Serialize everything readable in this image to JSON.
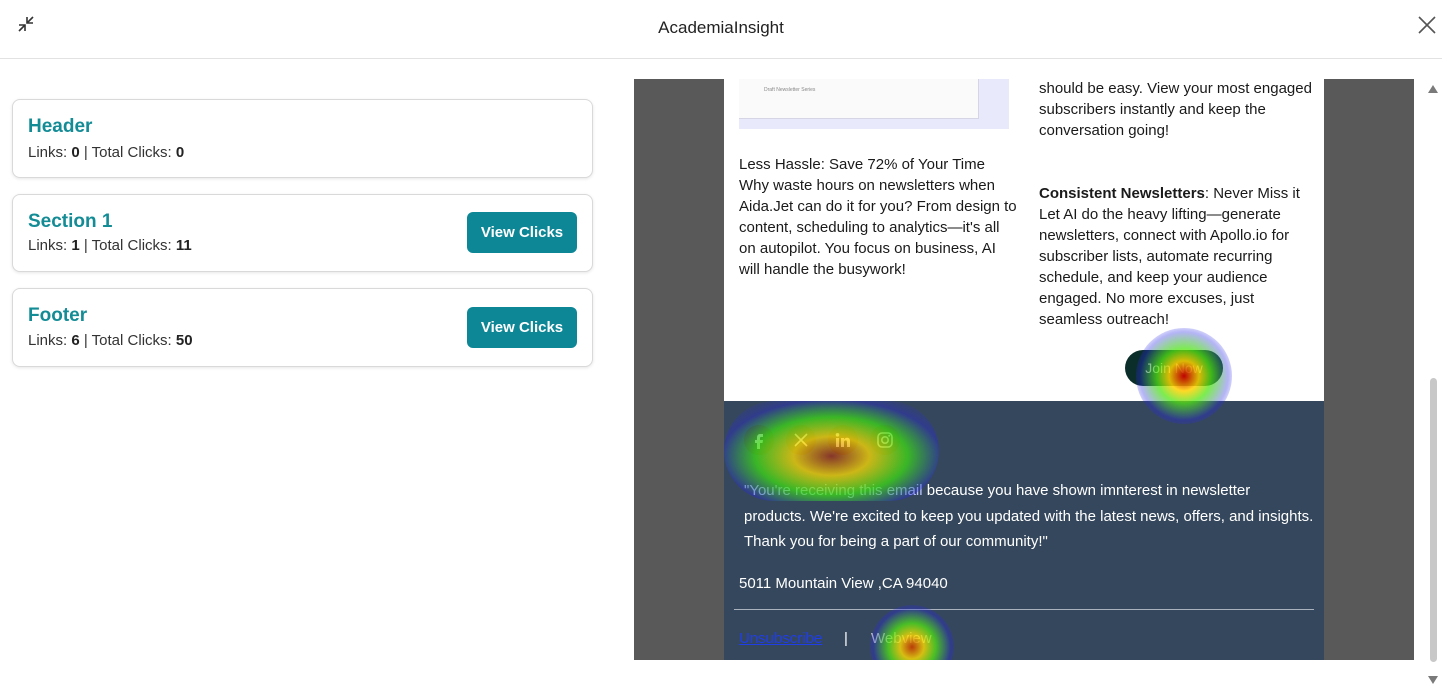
{
  "app": {
    "title": "AcademiaInsight"
  },
  "sections": [
    {
      "name": "Header",
      "links_label": "Links:",
      "links": "0",
      "clicks_label": "Total Clicks:",
      "clicks": "0",
      "button": ""
    },
    {
      "name": "Section 1",
      "links_label": "Links:",
      "links": "1",
      "clicks_label": "Total Clicks:",
      "clicks": "11",
      "button": "View Clicks"
    },
    {
      "name": "Footer",
      "links_label": "Links:",
      "links": "6",
      "clicks_label": "Total Clicks:",
      "clicks": "50",
      "button": "View Clicks"
    }
  ],
  "email": {
    "image_caption": "Draft Newsletter Series",
    "left_text": "Less Hassle: Save 72% of Your Time Why waste hours on newsletters when Aida.Jet can do it for you? From design to content, scheduling to analytics—it's all on autopilot. You focus on business, AI will handle the busywork!",
    "right_top_text": "should be easy. View your most engaged subscribers instantly and keep the conversation going!",
    "right_heading": "Consistent Newsletters",
    "right_body": ": Never Miss it Let AI do the heavy lifting—generate newsletters, connect with Apollo.io for subscriber lists, automate recurring schedule, and keep your audience engaged. No more excuses, just seamless outreach!",
    "join_button": "Join Now",
    "footer": {
      "social": [
        "facebook-icon",
        "x-icon",
        "linkedin-icon",
        "instagram-icon"
      ],
      "msg_highlight": "\"You're receiving this email",
      "msg_rest": " because you have shown imnterest in newsletter products. We're excited to keep you updated with the latest news, offers, and insights. Thank you for being a part of our community!\"",
      "address": "5011 Mountain View ,CA 94040",
      "unsubscribe": "Unsubscribe",
      "separator": "|",
      "webview": "Webview"
    }
  },
  "colors": {
    "accent": "#138c96",
    "button": "#0d8796",
    "footer_bg": "#35475c",
    "preview_bg": "#595959"
  }
}
